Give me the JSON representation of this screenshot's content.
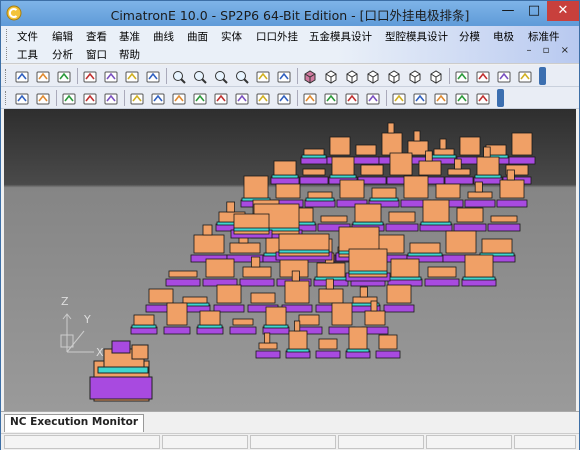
{
  "window": {
    "title": "CimatronE 10.0 - SP2P6 64-Bit Edition - [口口外挂电极排条]",
    "controls": {
      "minimize": "—",
      "maximize": "□",
      "close": "✕"
    }
  },
  "menubar": {
    "row1": [
      "文件",
      "编辑",
      "查看",
      "基准",
      "曲线",
      "曲面",
      "实体",
      "口口外挂",
      "五金模具设计",
      "型腔模具设计",
      "分模",
      "电极",
      "标准件"
    ],
    "row2": [
      "工具",
      "分析",
      "窗口",
      "帮助"
    ],
    "mdi_controls": "– ▫ ×"
  },
  "toolbars": {
    "row1_icons": [
      "new-icon",
      "open-icon",
      "save-icon",
      "undo-icon",
      "redo-icon",
      "link-icon",
      "tree-icon",
      "zoom-window-icon",
      "zoom-in-icon",
      "zoom-out-icon",
      "zoom-icon",
      "pan-icon",
      "rotate-icon",
      "shaded-cube-icon",
      "wire-cube-icon",
      "iso-cube-icon",
      "front-cube-icon",
      "top-cube-icon",
      "right-cube-icon",
      "bottom-cube-icon",
      "light-icon",
      "render-icon",
      "layer-icon",
      "measure-icon"
    ],
    "row2_icons": [
      "select-icon",
      "delete-icon",
      "select-filter-icon",
      "pick-icon",
      "copy-icon",
      "paste-icon",
      "move-icon",
      "shape-icon",
      "fillet-icon",
      "blend-icon",
      "transform-icon",
      "align-icon",
      "swap-icon",
      "sketch-icon",
      "tools-icon",
      "edit-icon",
      "trim-icon",
      "point-icon",
      "line-icon",
      "curve-icon",
      "check-icon",
      "spline-icon"
    ]
  },
  "bottom_tabs": {
    "active": "NC Execution Monitor"
  },
  "axes": {
    "z": "Z",
    "y": "Y",
    "x": "X"
  },
  "colors": {
    "titlebar": "#6fa8e0",
    "close_button": "#c8403c",
    "viewport_top": "#3a3a3a",
    "viewport_bottom": "#8c8c8c",
    "part_orange": "#f0a066",
    "part_purple": "#a84ae0",
    "part_cyan": "#3fd6cf"
  }
}
